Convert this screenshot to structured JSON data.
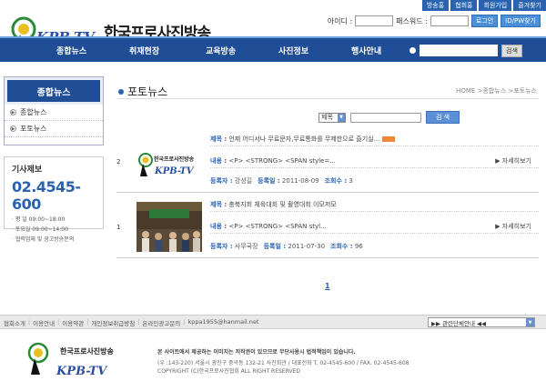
{
  "top_links": [
    "방송홍",
    "협회홍",
    "회원가입",
    "즐겨찾기"
  ],
  "header": {
    "title": "한국프로사진방송",
    "logo_text": "KPB-TV",
    "id_label": "아이디 :",
    "pw_label": "패스워드 :",
    "login_btn": "로그인",
    "find_btn": "ID/PW찾기"
  },
  "nav": {
    "items": [
      "종합뉴스",
      "취재현장",
      "교육방송",
      "사진정보",
      "행사안내"
    ],
    "search_btn": "검색"
  },
  "sidebar": {
    "heading": "종합뉴스",
    "items": [
      "종합뉴스",
      "포토뉴스"
    ]
  },
  "contact": {
    "title": "기사제보",
    "phone": "02.4545-600",
    "lines": [
      "· 평  일     09:00~18:00",
      "· 토요일     09:00~14:00",
      "· 협력업체 및 광고방송문의"
    ]
  },
  "main": {
    "page_title": "포토뉴스",
    "breadcrumb": "HOME >종합뉴스 >포토뉴스",
    "search_select": "제목",
    "search_btn": "검 색",
    "more_label": "▶ 자세히보기",
    "pager": "1"
  },
  "items": [
    {
      "num": "2",
      "subject_label": "제목 :",
      "subject": "언제 어디서나 무료문자,무료통화를 무제한으로 즐기실...",
      "content_label": "내용 :",
      "content": "<P> <STRONG> <SPAN style=...",
      "writer_label": "등록자 :",
      "writer": "강성길",
      "date_label": "등록일 :",
      "date": "2011-08-09",
      "views_label": "조회수 :",
      "views": "3"
    },
    {
      "num": "1",
      "subject_label": "제목 :",
      "subject": "충북지회 체육대회 및 촬영대회 이모저모",
      "content_label": "내용 :",
      "content": "<P> <STRONG> <SPAN styl...",
      "writer_label": "등록자 :",
      "writer": "사무국장",
      "date_label": "등록일 :",
      "date": "2011-07-30",
      "views_label": "조회수 :",
      "views": "96"
    }
  ],
  "footer": {
    "links": [
      "협회소개",
      "이용안내",
      "이용약관",
      "개인정보취급방침",
      "온라인광고문의",
      "kppa1955@hanmail.net"
    ],
    "related": "▶▶ 관련단체안내 ◀◀",
    "title": "한국프로사진방송",
    "notice": "본 사이트에서 제공하는 이미지는 저작권이 있으므로 무단사용시 법적책임이 있습니다.",
    "address": "(우 :143-220) 서울시 광진구 중곡동 132-21 사진회관 / 대표전화 T. 02-4545-600 / FAX. 02-4545-608",
    "copyright": "COPYRIGHT (C)한국프로사진협회 ALL RIGHT RESERVED"
  },
  "colors": {
    "nav_blue": "#1f4e96",
    "accent_blue": "#2a62b0",
    "badge_orange": "#f0883a"
  }
}
